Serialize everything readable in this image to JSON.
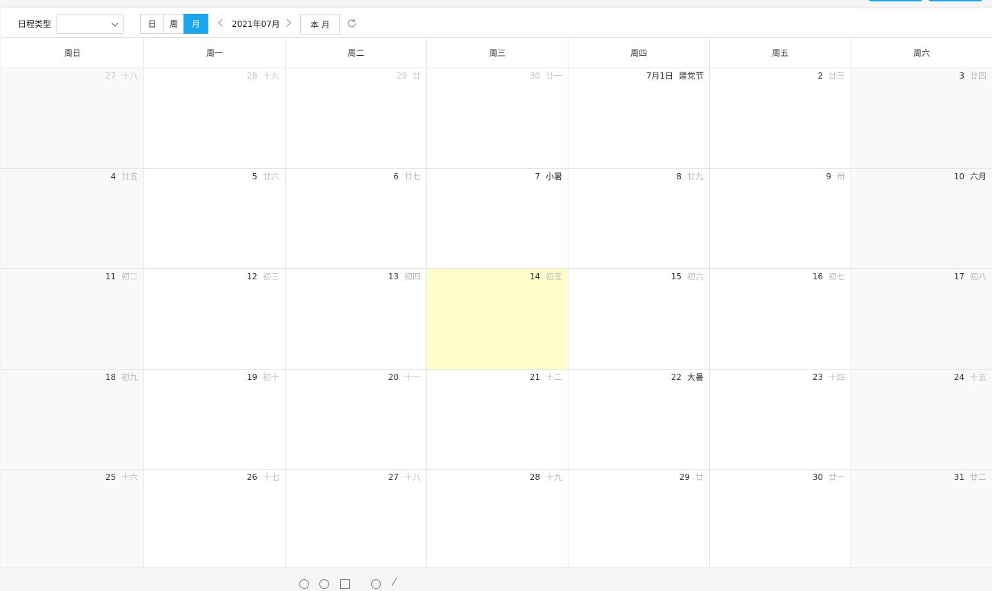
{
  "toolbar": {
    "type_label": "日程类型",
    "type_select_value": "",
    "view_day": "日",
    "view_week": "周",
    "view_month": "月",
    "current_date": "2021年07月",
    "this_month": "本 月",
    "icons": {
      "prev": "chevron-left-icon",
      "next": "chevron-right-icon",
      "refresh": "refresh-icon",
      "select": "chevron-down-icon"
    }
  },
  "colors": {
    "accent": "#1aa6ee",
    "today": "#ffffc9",
    "weekend": "#f9f9f9"
  },
  "weekdays": [
    "周日",
    "周一",
    "周二",
    "周三",
    "周四",
    "周五",
    "周六"
  ],
  "weeks": [
    [
      {
        "d": "27",
        "l": "十八",
        "other": true
      },
      {
        "d": "28",
        "l": "十九",
        "other": true
      },
      {
        "d": "29",
        "l": "廿",
        "other": true
      },
      {
        "d": "30",
        "l": "廿一",
        "other": true
      },
      {
        "d": "7月1日",
        "l": "建党节",
        "hl": true
      },
      {
        "d": "2",
        "l": "廿三"
      },
      {
        "d": "3",
        "l": "廿四"
      }
    ],
    [
      {
        "d": "4",
        "l": "廿五"
      },
      {
        "d": "5",
        "l": "廿六"
      },
      {
        "d": "6",
        "l": "廿七"
      },
      {
        "d": "7",
        "l": "小暑",
        "hl": true
      },
      {
        "d": "8",
        "l": "廿九"
      },
      {
        "d": "9",
        "l": "卅"
      },
      {
        "d": "10",
        "l": "六月",
        "hl": true
      }
    ],
    [
      {
        "d": "11",
        "l": "初二"
      },
      {
        "d": "12",
        "l": "初三"
      },
      {
        "d": "13",
        "l": "初四"
      },
      {
        "d": "14",
        "l": "初五",
        "today": true
      },
      {
        "d": "15",
        "l": "初六"
      },
      {
        "d": "16",
        "l": "初七"
      },
      {
        "d": "17",
        "l": "初八"
      }
    ],
    [
      {
        "d": "18",
        "l": "初九"
      },
      {
        "d": "19",
        "l": "初十"
      },
      {
        "d": "20",
        "l": "十一"
      },
      {
        "d": "21",
        "l": "十二"
      },
      {
        "d": "22",
        "l": "大暑",
        "hl": true
      },
      {
        "d": "23",
        "l": "十四"
      },
      {
        "d": "24",
        "l": "十五"
      }
    ],
    [
      {
        "d": "25",
        "l": "十六"
      },
      {
        "d": "26",
        "l": "十七"
      },
      {
        "d": "27",
        "l": "十八"
      },
      {
        "d": "28",
        "l": "十九"
      },
      {
        "d": "29",
        "l": "廿"
      },
      {
        "d": "30",
        "l": "廿一"
      },
      {
        "d": "31",
        "l": "廿二"
      }
    ]
  ]
}
